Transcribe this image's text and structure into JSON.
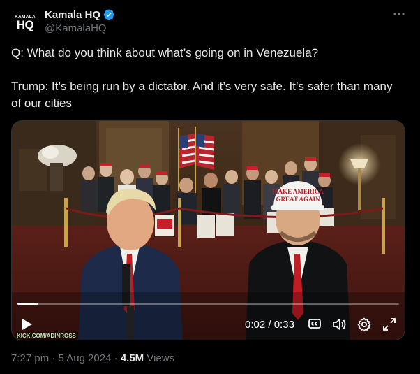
{
  "author": {
    "avatar_small": "KAMALA",
    "avatar_big": "HQ",
    "display_name": "Kamala HQ",
    "handle": "@KamalaHQ",
    "verified": true,
    "verified_color": "#1d9bf0"
  },
  "tweet": {
    "line1": "Q: What do you think about what’s going on in Venezuela?",
    "line2": "Trump: It’s being run by a dictator. And it’s very safe. It’s safer than many",
    "line3": "of our cities"
  },
  "video": {
    "current_time": "0:02",
    "separator": " / ",
    "duration": "0:33",
    "progress_fraction": 0.055,
    "watermark": "KICK.COM/ADINROSS",
    "hat_line1": "MAKE AMERICA",
    "hat_line2": "GREAT AGAIN"
  },
  "footer": {
    "time": "7:27 pm",
    "dot": " · ",
    "date": "5 Aug 2024",
    "views_count": "4.5M",
    "views_label": " Views"
  }
}
